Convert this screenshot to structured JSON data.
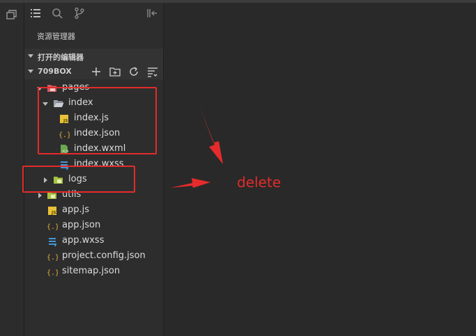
{
  "app": {
    "accent": "#e52b2b"
  },
  "activity_bar": {
    "icons": [
      "window-icon"
    ]
  },
  "sidebar": {
    "tab_icons": [
      "list-icon",
      "search-icon",
      "git-branch-icon",
      "collapse-panel-icon"
    ],
    "explorer_title": "资源管理器",
    "open_editors": {
      "label": "打开的编辑器",
      "expanded": true
    },
    "project": {
      "label": "709BOX",
      "expanded": true,
      "action_icons": [
        "new-file-icon",
        "new-folder-icon",
        "refresh-icon",
        "collapse-all-icon"
      ]
    },
    "tree": {
      "pages": "pages",
      "index": "index",
      "index_js": "index.js",
      "index_json": "index.json",
      "index_wxml": "index.wxml",
      "index_wxss": "index.wxss",
      "logs": "logs",
      "utils": "utils",
      "app_js": "app.js",
      "app_json": "app.json",
      "app_wxss": "app.wxss",
      "project_config": "project.config.json",
      "sitemap": "sitemap.json"
    },
    "file_icon_colors": {
      "js": "#e8c139",
      "json": "#e8b23a",
      "wxml": "#6aa84f",
      "wxss": "#4aa3e8",
      "folder_pages": "#d95b5b",
      "folder_logs": "#a8c33f"
    }
  },
  "annotation": {
    "text": "delete",
    "color": "#e52b2b"
  }
}
